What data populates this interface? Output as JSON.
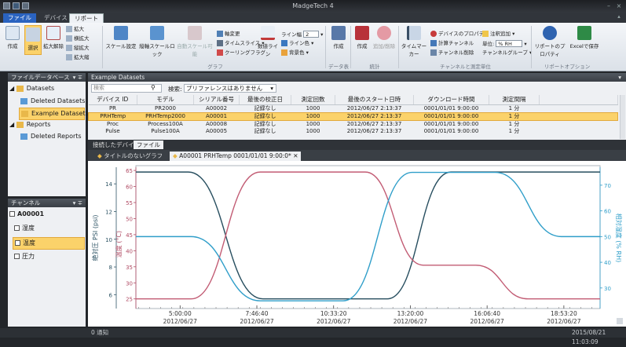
{
  "window": {
    "title": "MadgeTech 4"
  },
  "tabs": {
    "file": "ファイル",
    "device": "デバイス",
    "report": "リポート"
  },
  "ribbon": {
    "create": "作成",
    "select": "選択",
    "zoom_all": "拡大解除",
    "enlarge": "拡大",
    "zoom_h": "横拡大",
    "zoom_v": "縦拡大",
    "zoom_in": "拡大縮",
    "scale_settings": "スケール設定",
    "vertical_scale_lock": "縦軸スケールロック",
    "auto_scale": "自動スケール可能",
    "graph_group": "グラフ",
    "axis_change": "軸変更",
    "timeslice": "タイムスライス",
    "cooling_flag": "クーリングフラグ",
    "numeric_line": "数値ライン",
    "line_width_label": "ライン幅",
    "line_width_value": "2",
    "line_color": "ライン色",
    "background_color": "背景色",
    "data_table_create": "作成",
    "data_group": "データ表",
    "stats_create": "作成",
    "stats_group": "統計",
    "add_remove": "追加/削除",
    "time_marker": "タイムマーカー",
    "device_properties": "デバイスのプロパティ",
    "annotation_add": "注釈追加",
    "calc_channel": "計算チャンネル",
    "unit_label": "単位:",
    "unit_value": "% RH",
    "channel_delete": "チャンネル削除",
    "channel_group": "チャンネルグループ",
    "channel_measure_group": "チャンネルと測定単位",
    "report_properties": "リポートのプロパティ",
    "excel_save": "Excelで保存",
    "report_options": "リポートオプション"
  },
  "sidebar": {
    "header": "ファイルデータベース",
    "items": [
      "Datasets",
      "Deleted Datasets",
      "Example Datasets",
      "Reports",
      "Deleted Reports"
    ]
  },
  "channels": {
    "header": "チャンネル",
    "device": "A00001",
    "items": [
      "湿度",
      "温度",
      "圧力"
    ]
  },
  "datasets": {
    "header": "Example Datasets",
    "search_label": "検索",
    "search_field_label": "検索:",
    "preference": "プリファレンスはありません",
    "columns": [
      "デバイス ID",
      "モデル",
      "シリアル番号",
      "最後の校正日",
      "測定回数",
      "最後のスタート日時",
      "ダウンロード時間",
      "測定間隔"
    ],
    "rows": [
      [
        "PR",
        "PR2000",
        "A00002",
        "記録なし",
        "1000",
        "2012/06/27 2:13:37",
        "0001/01/01 9:00:00",
        "1 分"
      ],
      [
        "PRHTemp",
        "PRHTemp2000",
        "A00001",
        "記録なし",
        "1000",
        "2012/06/27 2:13:37",
        "0001/01/01 9:00:00",
        "1 分"
      ],
      [
        "Proc",
        "Process100A",
        "A00008",
        "記録なし",
        "1000",
        "2012/06/27 2:13:37",
        "0001/01/01 9:00:00",
        "1 分"
      ],
      [
        "Pulse",
        "Pulse100A",
        "A00005",
        "記録なし",
        "1000",
        "2012/06/27 2:13:37",
        "0001/01/01 9:00:00",
        "1 分"
      ]
    ]
  },
  "bottom_tabs": {
    "connected": "接続したデバイス",
    "file": "ファイル"
  },
  "doc_tabs": {
    "untitled": "タイトルのないグラフ",
    "active": "A00001 PRHTemp 0001/01/01 9:00:0*"
  },
  "chart_data": {
    "type": "line",
    "x_labels": [
      "5:00:00",
      "7:46:40",
      "10:33:20",
      "13:20:00",
      "16:06:40",
      "18:53:20"
    ],
    "x_dates": [
      "2012/06/27",
      "2012/06/27",
      "2012/06/27",
      "2012/06/27",
      "2012/06/27",
      "2012/06/27"
    ],
    "y_left_pressure": {
      "label": "絶対圧 PSI (psi)",
      "ticks": [
        14,
        12,
        10,
        8,
        6
      ],
      "range": [
        5,
        15.2
      ]
    },
    "y_left_temp": {
      "label": "温度 (°C)",
      "ticks": [
        65,
        60,
        55,
        50,
        45,
        40,
        35,
        30,
        25
      ],
      "range": [
        22,
        66
      ]
    },
    "y_right": {
      "label": "相対湿度 (% RH)",
      "ticks": [
        70,
        60,
        50,
        40,
        30
      ],
      "range": [
        22,
        77
      ]
    },
    "series": [
      {
        "color": "#274e5f",
        "axis": "temp",
        "points": [
          [
            3.4,
            64.5
          ],
          [
            5.3,
            64.5
          ],
          [
            8.0,
            25
          ],
          [
            12.5,
            25
          ],
          [
            14.8,
            64.5
          ],
          [
            20.2,
            64.5
          ]
        ]
      },
      {
        "color": "#c25c74",
        "axis": "temp",
        "points": [
          [
            3.4,
            25
          ],
          [
            5.4,
            25
          ],
          [
            7.9,
            64.5
          ],
          [
            11.7,
            64.5
          ],
          [
            13.8,
            35.5
          ],
          [
            15.7,
            35.5
          ],
          [
            17.6,
            25
          ],
          [
            20.2,
            25
          ]
        ]
      },
      {
        "color": "#2f9ec9",
        "axis": "rh",
        "points": [
          [
            3.4,
            50
          ],
          [
            5.4,
            50
          ],
          [
            7.9,
            25
          ],
          [
            10.9,
            25
          ],
          [
            13.4,
            75
          ],
          [
            16.4,
            75
          ],
          [
            18.8,
            50
          ],
          [
            20.2,
            50
          ]
        ]
      }
    ],
    "x_range": [
      3.4,
      20.2
    ],
    "grid": false
  },
  "status": {
    "left": "0 通知",
    "right": "2015/08/21 11:03:09"
  }
}
